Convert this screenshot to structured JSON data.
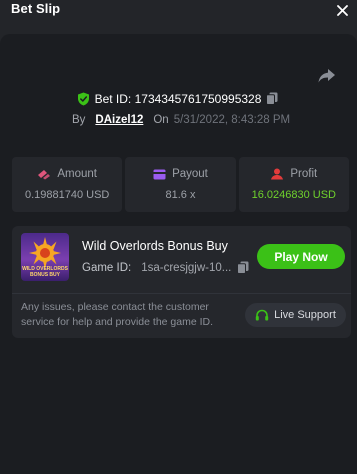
{
  "header": {
    "title": "Bet Slip",
    "close_icon": "close-icon"
  },
  "bet": {
    "bet_id": "Bet ID: 1734345761750995328",
    "by_label": "By",
    "username": "DAizel12",
    "on_label": "On",
    "date": "5/31/2022, 8:43:28 PM"
  },
  "stats": [
    {
      "label": "Amount",
      "value": "0.19881740 USD",
      "icon": "coins-icon",
      "icon_color": "#e0567c"
    },
    {
      "label": "Payout",
      "value": "81.6 x",
      "icon": "card-icon",
      "icon_color": "#9b5cf0"
    },
    {
      "label": "Profit",
      "value": "16.0246830 USD",
      "icon": "profit-icon",
      "icon_color": "#e23b3b",
      "value_color": "#6fd22c"
    }
  ],
  "game": {
    "thumb_text": "WILD OVERLORDS BONUS BUY",
    "title": "Wild Overlords Bonus Buy",
    "id_label": "Game ID:",
    "id_value": "1sa-cresjgjw-10...",
    "play_label": "Play Now",
    "issues_text": "Any issues, please contact the customer service for help and provide the game ID.",
    "support_label": "Live Support"
  },
  "colors": {
    "accent_green": "#3bc117",
    "background": "#1b1d21"
  }
}
